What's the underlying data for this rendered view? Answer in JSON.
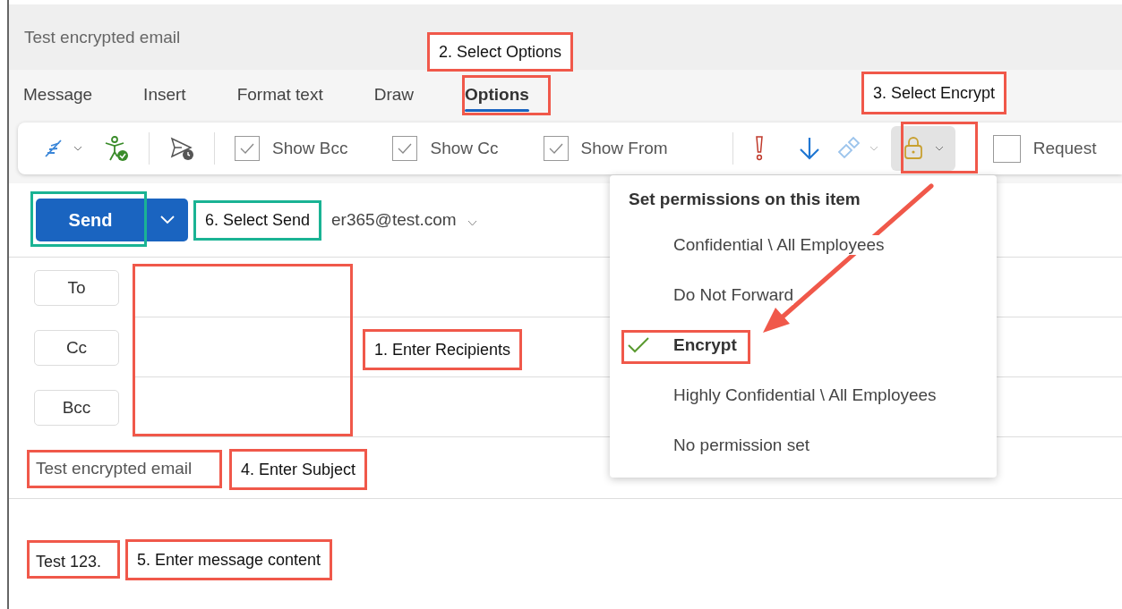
{
  "window": {
    "title": "Test encrypted email"
  },
  "tabs": [
    {
      "label": "Message",
      "selected": false
    },
    {
      "label": "Insert",
      "selected": false
    },
    {
      "label": "Format text",
      "selected": false
    },
    {
      "label": "Draw",
      "selected": false
    },
    {
      "label": "Options",
      "selected": true
    }
  ],
  "toolbar": {
    "checkboxes": [
      {
        "label": "Show Bcc",
        "checked": true
      },
      {
        "label": "Show Cc",
        "checked": true
      },
      {
        "label": "Show From",
        "checked": true
      }
    ],
    "encrypt_button": {
      "active": true
    },
    "request_checkbox": {
      "label": "Request",
      "checked": false
    }
  },
  "send_button": {
    "label": "Send"
  },
  "from": "er365@test.com",
  "recipients": [
    {
      "label": "To"
    },
    {
      "label": "Cc"
    },
    {
      "label": "Bcc"
    }
  ],
  "subject": {
    "value": "Test encrypted email"
  },
  "body": {
    "text": "Test 123."
  },
  "permissions_menu": {
    "title": "Set permissions on this item",
    "items": [
      {
        "label": "Confidential \\ All Employees",
        "selected": false
      },
      {
        "label": "Do Not Forward",
        "selected": false
      },
      {
        "label": "Encrypt",
        "selected": true
      },
      {
        "label": "Highly Confidential \\ All Employees",
        "selected": false
      },
      {
        "label": "No permission set",
        "selected": false
      }
    ]
  },
  "annotations": [
    {
      "text": "2. Select Options",
      "color": "#f0584a"
    },
    {
      "text": "3. Select Encrypt",
      "color": "#f0584a"
    },
    {
      "text": "6. Select Send",
      "color": "#1ab394"
    },
    {
      "text": "1. Enter Recipients",
      "color": "#f0584a"
    },
    {
      "text": "4. Enter Subject",
      "color": "#f0584a"
    },
    {
      "text": "5. Enter message content",
      "color": "#f0584a"
    }
  ],
  "highlights": [
    {
      "color": "#f0584a"
    },
    {
      "color": "#f0584a"
    },
    {
      "color": "#f0584a"
    },
    {
      "color": "#1ab394"
    },
    {
      "color": "#f0584a"
    },
    {
      "color": "#f0584a"
    },
    {
      "color": "#f0584a"
    }
  ]
}
